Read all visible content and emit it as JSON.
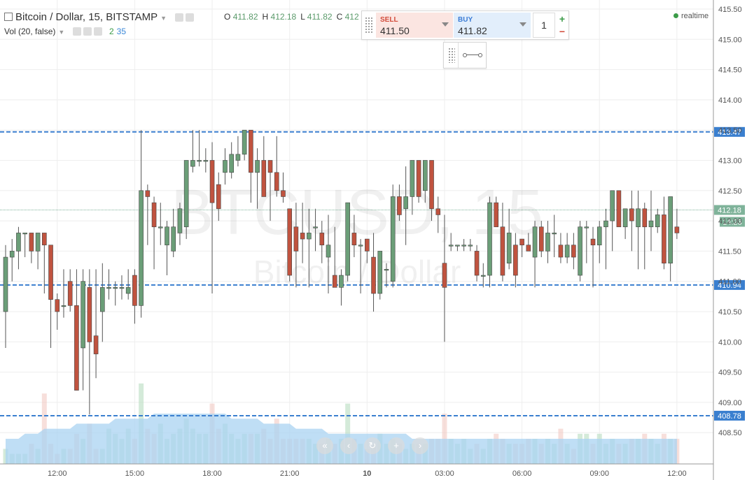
{
  "header": {
    "title": "Bitcoin / Dollar, 15, BITSTAMP",
    "ohlc": {
      "o_label": "O",
      "o": "411.82",
      "h_label": "H",
      "h": "412.18",
      "l_label": "L",
      "l": "411.82",
      "c_label": "C",
      "c": "412"
    },
    "volume_label": "Vol (20, false)",
    "vol_green": "2",
    "vol_blue": "35",
    "realtime": "realtime"
  },
  "trade_panel": {
    "sell_label": "SELL",
    "sell_price": "411.50",
    "buy_label": "BUY",
    "buy_price": "411.82",
    "quantity": "1",
    "plus_icon": "+",
    "minus_icon": "−"
  },
  "watermark": {
    "symbol": "BTCUSD, 15",
    "name": "Bitcoin / Dollar"
  },
  "nav_icons": [
    "chevrons-left-icon",
    "chevron-left-icon",
    "reset-icon",
    "zoom-in-icon",
    "chevron-right-icon"
  ],
  "colors": {
    "up": "#6b9e78",
    "down": "#c0533f",
    "hline": "#3a7fcf",
    "vol_area": "#a9d3f2",
    "last_price": "#7fb39a",
    "axis_text": "#555"
  },
  "chart_data": {
    "type": "candlestick",
    "title": "Bitcoin / Dollar, 15, BITSTAMP",
    "xlabel": "",
    "ylabel": "",
    "ylim": [
      408.1,
      415.6
    ],
    "y_ticks": [
      "415.50",
      "415.00",
      "414.50",
      "414.00",
      "413.50",
      "413.00",
      "412.50",
      "412.00",
      "411.50",
      "411.00",
      "410.50",
      "410.00",
      "409.50",
      "409.00",
      "408.50"
    ],
    "x_ticks": [
      "12:00",
      "15:00",
      "18:00",
      "21:00",
      "10",
      "03:00",
      "06:00",
      "09:00",
      "12:00"
    ],
    "x_tick_index": [
      8,
      20,
      32,
      44,
      56,
      68,
      80,
      92,
      104
    ],
    "grid": true,
    "horizontal_lines": [
      {
        "value": "413.47"
      },
      {
        "value": "410.94"
      },
      {
        "value": "408.78"
      }
    ],
    "last_price": "412.18",
    "countdown": "14:23",
    "candles": [
      {
        "o": 410.5,
        "h": 411.6,
        "l": 409.9,
        "c": 411.4
      },
      {
        "o": 411.4,
        "h": 411.7,
        "l": 411.0,
        "c": 411.5
      },
      {
        "o": 411.5,
        "h": 411.9,
        "l": 411.2,
        "c": 411.8
      },
      {
        "o": 411.8,
        "h": 411.8,
        "l": 411.4,
        "c": 411.8
      },
      {
        "o": 411.8,
        "h": 411.8,
        "l": 411.3,
        "c": 411.5
      },
      {
        "o": 411.5,
        "h": 411.8,
        "l": 411.2,
        "c": 411.8
      },
      {
        "o": 411.8,
        "h": 411.8,
        "l": 410.8,
        "c": 411.6
      },
      {
        "o": 411.6,
        "h": 411.6,
        "l": 409.9,
        "c": 410.7
      },
      {
        "o": 410.7,
        "h": 410.8,
        "l": 410.2,
        "c": 410.5
      },
      {
        "o": 410.6,
        "h": 411.2,
        "l": 410.4,
        "c": 410.6
      },
      {
        "o": 411.0,
        "h": 411.2,
        "l": 410.5,
        "c": 410.6
      },
      {
        "o": 410.6,
        "h": 411.2,
        "l": 409.2,
        "c": 409.2
      },
      {
        "o": 409.9,
        "h": 411.2,
        "l": 409.2,
        "c": 411.0
      },
      {
        "o": 410.9,
        "h": 411.2,
        "l": 408.8,
        "c": 410.0
      },
      {
        "o": 410.1,
        "h": 411.2,
        "l": 409.4,
        "c": 409.8
      },
      {
        "o": 410.5,
        "h": 411.3,
        "l": 410.0,
        "c": 410.9
      },
      {
        "o": 410.9,
        "h": 411.2,
        "l": 410.7,
        "c": 410.9
      },
      {
        "o": 410.9,
        "h": 411.0,
        "l": 410.6,
        "c": 410.9
      },
      {
        "o": 410.9,
        "h": 411.1,
        "l": 410.7,
        "c": 410.9
      },
      {
        "o": 410.8,
        "h": 411.2,
        "l": 410.7,
        "c": 410.9
      },
      {
        "o": 411.1,
        "h": 411.2,
        "l": 410.3,
        "c": 410.6
      },
      {
        "o": 410.6,
        "h": 413.5,
        "l": 410.4,
        "c": 412.5
      },
      {
        "o": 412.5,
        "h": 412.6,
        "l": 411.6,
        "c": 412.4
      },
      {
        "o": 412.3,
        "h": 412.4,
        "l": 411.2,
        "c": 411.9
      },
      {
        "o": 411.9,
        "h": 412.3,
        "l": 411.6,
        "c": 411.9
      },
      {
        "o": 411.6,
        "h": 412.0,
        "l": 411.1,
        "c": 411.9
      },
      {
        "o": 411.5,
        "h": 412.2,
        "l": 411.4,
        "c": 411.9
      },
      {
        "o": 411.8,
        "h": 412.3,
        "l": 411.6,
        "c": 412.2
      },
      {
        "o": 411.9,
        "h": 413.0,
        "l": 411.7,
        "c": 413.0
      },
      {
        "o": 412.9,
        "h": 413.5,
        "l": 412.8,
        "c": 413.0
      },
      {
        "o": 413.0,
        "h": 413.5,
        "l": 412.9,
        "c": 413.0
      },
      {
        "o": 413.0,
        "h": 413.2,
        "l": 412.8,
        "c": 413.0
      },
      {
        "o": 413.0,
        "h": 413.3,
        "l": 410.8,
        "c": 412.3
      },
      {
        "o": 412.6,
        "h": 412.8,
        "l": 412.0,
        "c": 412.2
      },
      {
        "o": 412.8,
        "h": 413.2,
        "l": 412.6,
        "c": 413.0
      },
      {
        "o": 412.8,
        "h": 413.3,
        "l": 412.7,
        "c": 413.1
      },
      {
        "o": 413.0,
        "h": 413.4,
        "l": 412.9,
        "c": 413.1
      },
      {
        "o": 413.1,
        "h": 413.4,
        "l": 413.0,
        "c": 413.5
      },
      {
        "o": 413.5,
        "h": 413.5,
        "l": 412.3,
        "c": 412.8
      },
      {
        "o": 412.8,
        "h": 413.2,
        "l": 412.2,
        "c": 413.0
      },
      {
        "o": 413.0,
        "h": 413.4,
        "l": 412.4,
        "c": 412.4
      },
      {
        "o": 413.0,
        "h": 413.0,
        "l": 412.0,
        "c": 412.8
      },
      {
        "o": 412.8,
        "h": 413.4,
        "l": 412.4,
        "c": 412.5
      },
      {
        "o": 412.5,
        "h": 412.8,
        "l": 412.3,
        "c": 412.4
      },
      {
        "o": 412.2,
        "h": 412.2,
        "l": 411.0,
        "c": 411.1
      },
      {
        "o": 411.9,
        "h": 412.3,
        "l": 410.9,
        "c": 411.5
      },
      {
        "o": 411.8,
        "h": 412.3,
        "l": 411.3,
        "c": 411.7
      },
      {
        "o": 411.7,
        "h": 412.2,
        "l": 410.9,
        "c": 411.8
      },
      {
        "o": 411.9,
        "h": 412.2,
        "l": 411.5,
        "c": 411.9
      },
      {
        "o": 411.8,
        "h": 412.0,
        "l": 411.3,
        "c": 411.6
      },
      {
        "o": 411.4,
        "h": 412.1,
        "l": 410.8,
        "c": 411.6
      },
      {
        "o": 411.1,
        "h": 411.9,
        "l": 411.0,
        "c": 410.9
      },
      {
        "o": 410.9,
        "h": 411.2,
        "l": 410.6,
        "c": 411.1
      },
      {
        "o": 411.1,
        "h": 412.3,
        "l": 411.0,
        "c": 412.3
      },
      {
        "o": 411.8,
        "h": 412.1,
        "l": 411.4,
        "c": 411.6
      },
      {
        "o": 411.6,
        "h": 411.7,
        "l": 410.8,
        "c": 411.6
      },
      {
        "o": 411.7,
        "h": 411.7,
        "l": 411.3,
        "c": 411.5
      },
      {
        "o": 411.4,
        "h": 411.8,
        "l": 410.5,
        "c": 410.8
      },
      {
        "o": 410.8,
        "h": 411.5,
        "l": 410.7,
        "c": 411.5
      },
      {
        "o": 411.2,
        "h": 411.3,
        "l": 410.9,
        "c": 411.2
      },
      {
        "o": 411.0,
        "h": 412.6,
        "l": 410.9,
        "c": 412.4
      },
      {
        "o": 412.4,
        "h": 412.6,
        "l": 412.0,
        "c": 412.1
      },
      {
        "o": 412.2,
        "h": 412.9,
        "l": 411.6,
        "c": 412.4
      },
      {
        "o": 412.4,
        "h": 413.0,
        "l": 412.1,
        "c": 413.0
      },
      {
        "o": 413.0,
        "h": 413.0,
        "l": 412.3,
        "c": 412.4
      },
      {
        "o": 412.5,
        "h": 413.0,
        "l": 412.3,
        "c": 413.0
      },
      {
        "o": 413.0,
        "h": 413.0,
        "l": 412.0,
        "c": 412.2
      },
      {
        "o": 412.2,
        "h": 412.4,
        "l": 411.8,
        "c": 412.1
      },
      {
        "o": 411.3,
        "h": 412.1,
        "l": 410.0,
        "c": 410.9
      },
      {
        "o": 411.6,
        "h": 411.8,
        "l": 411.5,
        "c": 411.6
      },
      {
        "o": 411.6,
        "h": 411.6,
        "l": 411.5,
        "c": 411.6
      },
      {
        "o": 411.6,
        "h": 411.7,
        "l": 411.5,
        "c": 411.6
      },
      {
        "o": 411.6,
        "h": 411.7,
        "l": 411.5,
        "c": 411.6
      },
      {
        "o": 411.5,
        "h": 411.6,
        "l": 411.0,
        "c": 411.1
      },
      {
        "o": 411.1,
        "h": 411.3,
        "l": 410.9,
        "c": 411.1
      },
      {
        "o": 411.1,
        "h": 412.4,
        "l": 410.9,
        "c": 412.3
      },
      {
        "o": 412.3,
        "h": 412.4,
        "l": 411.9,
        "c": 411.9
      },
      {
        "o": 411.9,
        "h": 412.3,
        "l": 411.0,
        "c": 411.1
      },
      {
        "o": 411.3,
        "h": 412.2,
        "l": 411.2,
        "c": 411.8
      },
      {
        "o": 411.6,
        "h": 411.8,
        "l": 410.9,
        "c": 411.1
      },
      {
        "o": 411.7,
        "h": 411.7,
        "l": 411.4,
        "c": 411.6
      },
      {
        "o": 411.6,
        "h": 411.8,
        "l": 411.5,
        "c": 411.5
      },
      {
        "o": 411.4,
        "h": 412.0,
        "l": 410.9,
        "c": 411.9
      },
      {
        "o": 411.9,
        "h": 412.0,
        "l": 411.4,
        "c": 411.5
      },
      {
        "o": 411.5,
        "h": 412.0,
        "l": 411.3,
        "c": 411.8
      },
      {
        "o": 411.8,
        "h": 412.1,
        "l": 411.4,
        "c": 411.8
      },
      {
        "o": 411.6,
        "h": 411.8,
        "l": 411.3,
        "c": 411.4
      },
      {
        "o": 411.4,
        "h": 411.8,
        "l": 411.3,
        "c": 411.6
      },
      {
        "o": 411.6,
        "h": 411.8,
        "l": 411.2,
        "c": 411.4
      },
      {
        "o": 411.1,
        "h": 412.0,
        "l": 411.0,
        "c": 411.9
      },
      {
        "o": 411.9,
        "h": 412.0,
        "l": 411.3,
        "c": 411.9
      },
      {
        "o": 411.7,
        "h": 411.9,
        "l": 410.9,
        "c": 411.6
      },
      {
        "o": 411.6,
        "h": 412.0,
        "l": 411.3,
        "c": 411.9
      },
      {
        "o": 411.9,
        "h": 412.2,
        "l": 411.2,
        "c": 412.0
      },
      {
        "o": 412.0,
        "h": 412.5,
        "l": 411.5,
        "c": 412.5
      },
      {
        "o": 412.5,
        "h": 412.5,
        "l": 411.9,
        "c": 411.9
      },
      {
        "o": 411.9,
        "h": 412.2,
        "l": 411.7,
        "c": 412.2
      },
      {
        "o": 412.2,
        "h": 412.5,
        "l": 411.5,
        "c": 412.0
      },
      {
        "o": 411.9,
        "h": 412.5,
        "l": 411.2,
        "c": 412.2
      },
      {
        "o": 412.2,
        "h": 412.3,
        "l": 411.2,
        "c": 411.9
      },
      {
        "o": 411.9,
        "h": 412.5,
        "l": 411.5,
        "c": 412.0
      },
      {
        "o": 411.9,
        "h": 412.2,
        "l": 411.8,
        "c": 412.1
      },
      {
        "o": 412.1,
        "h": 412.4,
        "l": 411.2,
        "c": 411.3
      },
      {
        "o": 411.3,
        "h": 412.4,
        "l": 411.0,
        "c": 412.4
      },
      {
        "o": 411.9,
        "h": 412.2,
        "l": 411.7,
        "c": 411.8
      }
    ],
    "volume": [
      3,
      2,
      2,
      2,
      4,
      3,
      14,
      4,
      2,
      3,
      3,
      6,
      5,
      8,
      3,
      3,
      7,
      6,
      5,
      7,
      5,
      16,
      7,
      6,
      8,
      5,
      6,
      7,
      9,
      7,
      6,
      6,
      12,
      7,
      8,
      6,
      5,
      6,
      6,
      6,
      7,
      5,
      9,
      5,
      5,
      5,
      5,
      5,
      4,
      4,
      5,
      4,
      5,
      12,
      5,
      4,
      3,
      4,
      6,
      4,
      5,
      4,
      3,
      4,
      4,
      4,
      5,
      5,
      10,
      5,
      4,
      5,
      3,
      4,
      3,
      5,
      6,
      5,
      4,
      4,
      4,
      5,
      5,
      4,
      5,
      4,
      7,
      4,
      3,
      6,
      6,
      4,
      6,
      4,
      5,
      4,
      4,
      5,
      5,
      6,
      5,
      4,
      6,
      5,
      5
    ],
    "volume_avg": [
      5,
      5,
      5,
      6,
      6,
      6,
      7,
      7,
      7,
      7,
      7,
      8,
      8,
      8,
      8,
      8,
      8,
      9,
      9,
      9,
      9,
      9,
      9,
      10,
      10,
      10,
      10,
      10,
      10,
      10,
      10,
      10,
      10,
      10,
      10,
      9,
      9,
      9,
      9,
      9,
      8,
      8,
      8,
      8,
      8,
      7,
      7,
      7,
      7,
      7,
      6,
      6,
      6,
      6,
      6,
      6,
      6,
      6,
      6,
      6,
      6,
      6,
      6,
      5,
      5,
      5,
      5,
      5,
      5,
      5,
      5,
      5,
      5,
      5,
      5,
      5,
      5,
      5,
      5,
      5,
      5,
      5,
      5,
      5,
      5,
      5,
      5,
      5,
      5,
      5,
      5,
      5,
      5,
      5,
      5,
      5,
      5,
      5,
      5,
      5,
      5,
      5,
      5,
      5,
      5
    ]
  }
}
